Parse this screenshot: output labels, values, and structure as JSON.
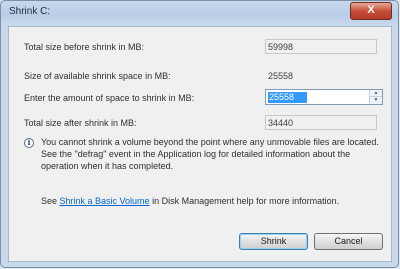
{
  "window": {
    "title": "Shrink C:",
    "close_glyph": "X"
  },
  "fields": {
    "total_before_label": "Total size before shrink in MB:",
    "total_before_value": "59998",
    "available_label": "Size of available shrink space in MB:",
    "available_value": "25558",
    "enter_label": "Enter the amount of space to shrink in MB:",
    "enter_value": "25558",
    "total_after_label": "Total size after shrink in MB:",
    "total_after_value": "34440"
  },
  "info": {
    "icon": "info-icon",
    "line1": "You cannot shrink a volume beyond the point where any unmovable files are located.",
    "line2": "See the \"defrag\" event in the Application log for detailed information about the",
    "line3": "operation when it has completed."
  },
  "help": {
    "prefix": "See ",
    "link": "Shrink a Basic Volume",
    "suffix": " in Disk Management help for more information."
  },
  "buttons": {
    "shrink": "Shrink",
    "cancel": "Cancel"
  }
}
